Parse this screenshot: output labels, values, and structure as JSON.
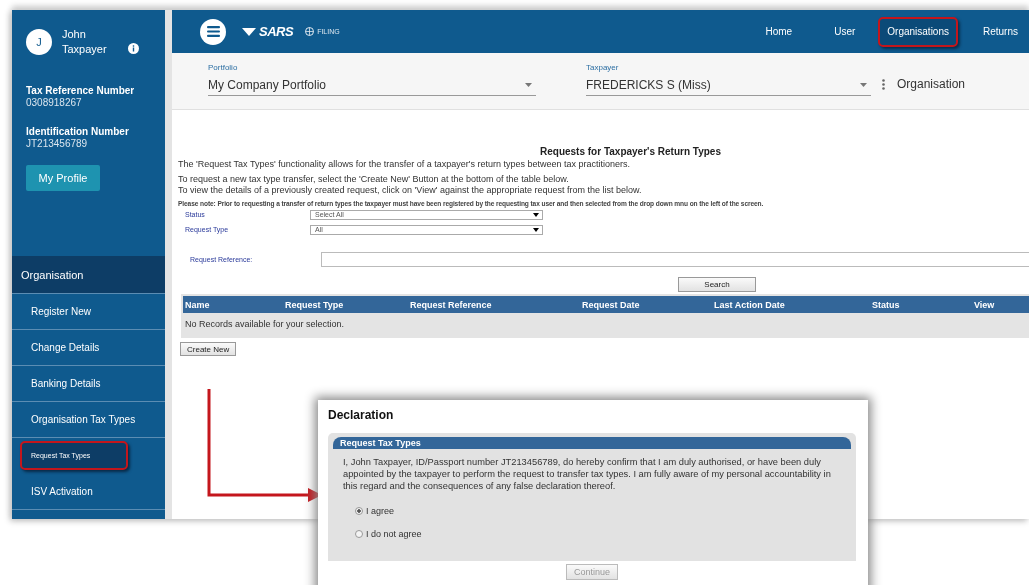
{
  "user": {
    "initial": "J",
    "name": "John Taxpayer"
  },
  "profile": [
    {
      "label": "Tax Reference Number",
      "value": "0308918267"
    },
    {
      "label": "Identification Number",
      "value": "JT213456789"
    }
  ],
  "profile_button": "My Profile",
  "sidebar": {
    "heading": "Organisation",
    "items": [
      {
        "label": "Register New",
        "selected": false,
        "highlighted": false
      },
      {
        "label": "Change Details",
        "selected": false,
        "highlighted": false
      },
      {
        "label": "Banking Details",
        "selected": false,
        "highlighted": false
      },
      {
        "label": "Organisation Tax Types",
        "selected": false,
        "highlighted": false
      },
      {
        "label": "Request Tax Types",
        "selected": true,
        "highlighted": true
      },
      {
        "label": "ISV Activation",
        "selected": false,
        "highlighted": false
      }
    ]
  },
  "topbar": {
    "brand": "SARS",
    "sub": "FILING",
    "nav": [
      {
        "label": "Home",
        "highlighted": false
      },
      {
        "label": "User",
        "highlighted": false
      },
      {
        "label": "Organisations",
        "highlighted": true
      },
      {
        "label": "Returns",
        "highlighted": false
      }
    ]
  },
  "filters": [
    {
      "label": "Portfolio",
      "value": "My Company Portfolio"
    },
    {
      "label": "Taxpayer",
      "value": "FREDERICKS S (Miss)"
    }
  ],
  "context": "Organisation",
  "page": {
    "title": "Requests for Taxpayer's Return Types",
    "intro": [
      "The 'Request Tax Types' functionality allows for the transfer of a taxpayer's return types between tax practitioners.",
      "To request a new tax type transfer, select the 'Create New' Button at the bottom of the table below.",
      "To view the details of a previously created request, click on 'View' against the appropriate request from the list below."
    ],
    "note": "Please note: Prior to requesting a transfer of return types the taxpayer must have been registered by the requesting tax user  and then selected from the drop down mnu on the left of the screen.",
    "form": [
      {
        "kind": "select",
        "label": "Status",
        "value": "Select All"
      },
      {
        "kind": "select",
        "label": "Request Type",
        "value": "All"
      },
      {
        "kind": "text",
        "label": "Request Reference:"
      }
    ],
    "search_button": "Search",
    "table": {
      "columns": [
        "Name",
        "Request Type",
        "Request Reference",
        "Request Date",
        "Last Action Date",
        "Status",
        "View"
      ],
      "empty": "No Records available for your selection."
    },
    "create_button": "Create New"
  },
  "dialog": {
    "title": "Declaration",
    "section": "Request Tax Types",
    "text": "I, John Taxpayer, ID/Passport number JT213456789, do hereby confirm that I am duly authorised, or have been duly appointed by the taxpayer to perform the request to transfer tax types. I am fully aware of my personal accountability in this regard and the consequences of any false declaration thereof.",
    "options": [
      {
        "label": "I agree",
        "selected": true
      },
      {
        "label": "I do not agree",
        "selected": false
      }
    ],
    "button": {
      "label": "Continue",
      "disabled": true
    }
  }
}
